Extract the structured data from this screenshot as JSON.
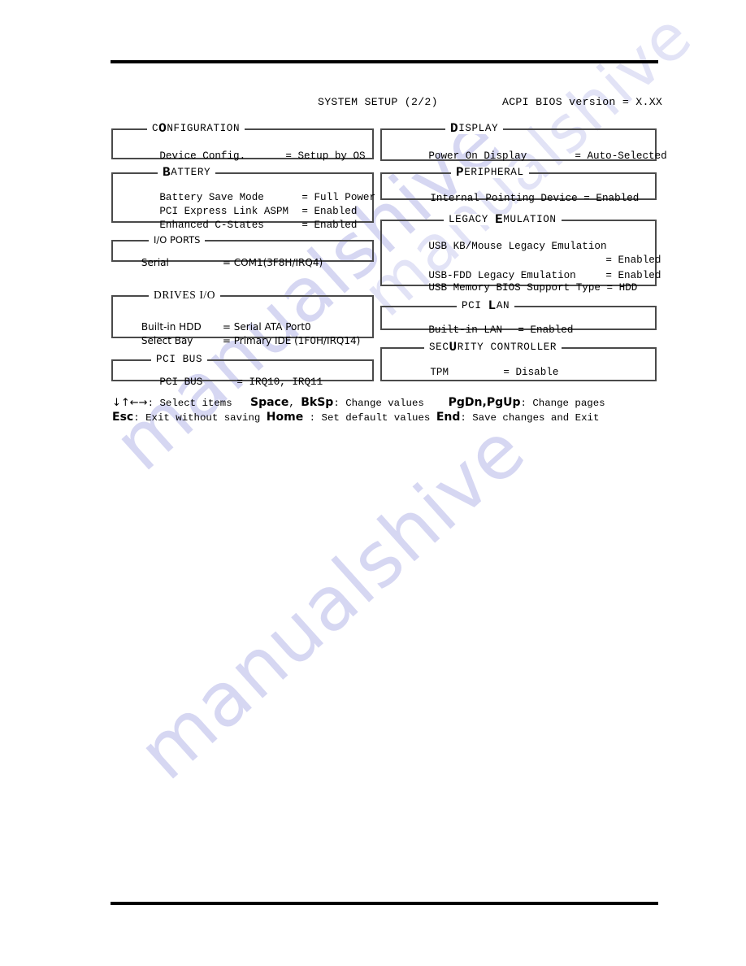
{
  "page": {
    "title_line": {
      "setup_title": "SYSTEM SETUP (2/2)",
      "bios_version": "ACPI BIOS version = X.XX"
    },
    "watermark": "manualshive"
  },
  "panels": {
    "configuration": {
      "legend_prefix": "C",
      "legend_hotkey": "O",
      "legend_suffix": "NFIGURATION",
      "rows": [
        {
          "label": "Device Config.",
          "value": "= Setup by OS"
        }
      ]
    },
    "battery": {
      "legend_prefix": "",
      "legend_hotkey": "B",
      "legend_suffix": "ATTERY",
      "rows": [
        {
          "label": "Battery Save Mode",
          "value": "= Full Power"
        },
        {
          "label": "PCI Express Link ASPM",
          "value": "= Enabled"
        },
        {
          "label": "Enhanced C-States",
          "value": "= Enabled"
        }
      ]
    },
    "io_ports": {
      "legend": "I/O PORTS",
      "rows": [
        {
          "label": "Serial",
          "value": "= COM1(3F8H/IRQ4)"
        }
      ]
    },
    "drives_io": {
      "legend": "DRIVES I/O",
      "rows": [
        {
          "label": "Built-in HDD",
          "value": "= Serial ATA Port0"
        },
        {
          "label": "Select Bay",
          "value": "= Primary IDE (1F0H/IRQ14)"
        }
      ]
    },
    "pci_bus": {
      "legend": "PCI BUS",
      "rows": [
        {
          "label": "PCI BUS",
          "value": "= IRQ10, IRQ11"
        }
      ]
    },
    "display": {
      "legend_prefix": "",
      "legend_hotkey": "D",
      "legend_suffix": "ISPLAY",
      "rows": [
        {
          "label": "Power On Display",
          "value": "= Auto-Selected"
        }
      ]
    },
    "peripheral": {
      "legend_prefix": "",
      "legend_hotkey": "P",
      "legend_suffix": "ERIPHERAL",
      "rows": [
        {
          "label": "Internal Pointing Device = Enabled",
          "value": ""
        }
      ]
    },
    "legacy_emulation": {
      "legend_prefix": "LEGACY ",
      "legend_hotkey": "E",
      "legend_suffix": "MULATION",
      "rows": [
        {
          "label": "USB KB/Mouse Legacy Emulation",
          "value": ""
        },
        {
          "label": "",
          "value": "= Enabled"
        },
        {
          "label": "USB-FDD Legacy Emulation",
          "value": "= Enabled"
        },
        {
          "label": "USB Memory BIOS Support Type = HDD",
          "value": ""
        }
      ]
    },
    "pci_lan": {
      "legend_prefix": "PCI ",
      "legend_hotkey": "L",
      "legend_suffix": "AN",
      "rows": [
        {
          "label": "Built-in LAN",
          "value": "= Enabled"
        }
      ]
    },
    "security_controller": {
      "legend_prefix": "SEC",
      "legend_hotkey": "U",
      "legend_suffix": "RITY CONTROLLER",
      "rows": [
        {
          "label": "TPM",
          "value": "= Disable"
        }
      ]
    }
  },
  "help": {
    "line1": {
      "arrows": "↓↑←→",
      "select_items": ": Select items",
      "key_space": "Space",
      "comma": ", ",
      "key_bksp": "BkSp",
      "change_values": ": Change values",
      "key_pages": "PgDn,PgUp",
      "change_pages": ": Change pages"
    },
    "line2": {
      "key_esc": "Esc",
      "exit_without_saving": ": Exit without saving",
      "key_home": "Home",
      "set_default_values": " : Set default values",
      "key_end": "End",
      "save_changes_and_exit": ": Save changes and Exit"
    }
  }
}
